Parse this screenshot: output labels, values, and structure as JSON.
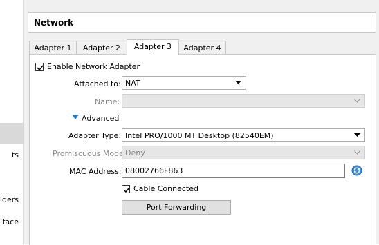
{
  "sidebar": {
    "items": [
      {
        "label": "ts"
      },
      {
        "label": "olders"
      },
      {
        "label": "face"
      }
    ]
  },
  "section": {
    "title": "Network"
  },
  "tabs": [
    "Adapter 1",
    "Adapter 2",
    "Adapter 3",
    "Adapter 4"
  ],
  "active_tab": "Adapter 3",
  "form": {
    "enable_label": "Enable Network Adapter",
    "enable_checked": true,
    "attached_label": "Attached to:",
    "attached_value": "NAT",
    "name_label": "Name:",
    "name_value": "",
    "advanced_label": "Advanced",
    "adapter_type_label": "Adapter Type:",
    "adapter_type_value": "Intel PRO/1000 MT Desktop (82540EM)",
    "promiscuous_label": "Promiscuous Mode:",
    "promiscuous_value": "Deny",
    "mac_label": "MAC Address:",
    "mac_value": "08002766F863",
    "cable_label": "Cable Connected",
    "cable_checked": true,
    "port_forwarding_label": "Port Forwarding"
  },
  "icons": {
    "advanced": "triangle-down-icon",
    "refresh": "refresh-icon"
  },
  "colors": {
    "accent": "#1e7bd6",
    "selection": "#d9d9d9"
  }
}
